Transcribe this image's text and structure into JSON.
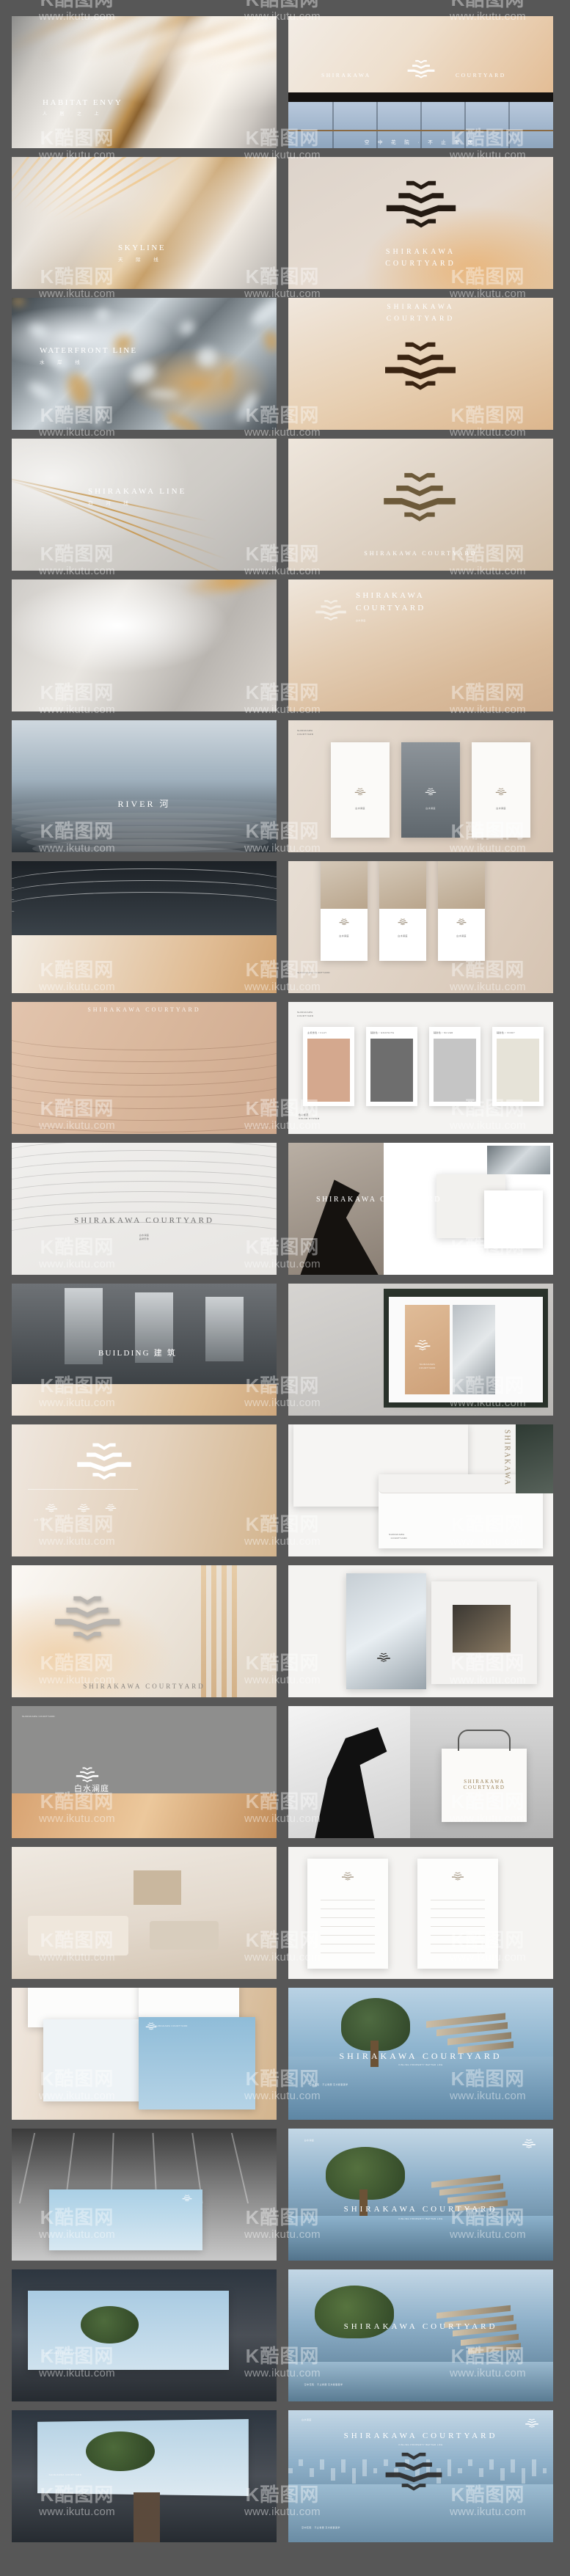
{
  "brand": {
    "name_en": "SHIRAKAWA COURTYARD",
    "name_en_line1": "SHIRAKAWA",
    "name_en_line2": "COURTYARD",
    "name_cn": "白水澜庭",
    "tagline_cn": "空 中 花 院 · 不 止 奢 居",
    "tagline_en": "KINLING PROPERTY BETTER LIFE",
    "logo_name": "wave-mark-logo"
  },
  "watermark": {
    "logo_text": "K酷图网",
    "url_text": "www.ikutu.com"
  },
  "colors": {
    "page_background": "#575757",
    "accent_gold": "#c39a62",
    "accent_clay": "#d7ab8f",
    "neutral_dark": "#6e6e6e",
    "neutral_mid": "#c5c5c5",
    "neutral_light": "#e6e3d8"
  },
  "palette": {
    "title": "色彩规范",
    "subtitle": "COLOR SYSTEM",
    "swatches": [
      {
        "label": "主视觉色 / CLAY",
        "hex": "#d4a88e"
      },
      {
        "label": "辅助色 / GRAPHITE",
        "hex": "#6e6e6e"
      },
      {
        "label": "辅助色 / SILVER",
        "hex": "#c5c5c5"
      },
      {
        "label": "辅助色 / IVORY",
        "hex": "#e6e3d8"
      }
    ]
  },
  "panels": [
    {
      "id": "p01",
      "name": "habitat-envy-silk",
      "caption_en": "HABITAT ENVY",
      "caption_cn": "人 居 之 上"
    },
    {
      "id": "p02",
      "name": "signage-wall-lobby",
      "caption_en": "SHIRAKAWA COURTYARD",
      "caption_cn": "空 中 花 院 · 不 止 奢 居"
    },
    {
      "id": "p03",
      "name": "skyline-architecture",
      "caption_en": "SKYLINE",
      "caption_cn": "天 际 线"
    },
    {
      "id": "p04",
      "name": "logo-texture-stone",
      "caption_en": "SHIRAKAWA COURTYARD",
      "caption_cn": ""
    },
    {
      "id": "p05",
      "name": "waterfront-texture",
      "caption_en": "WATERFRONT LINE",
      "caption_cn": "水 岸 线"
    },
    {
      "id": "p06",
      "name": "logo-texture-bronze",
      "caption_en": "SHIRAKAWA COURTYARD",
      "caption_cn": ""
    },
    {
      "id": "p07",
      "name": "shirakawa-line-glass",
      "caption_en": "SHIRAKAWA LINE",
      "caption_cn": "白 河 线"
    },
    {
      "id": "p08",
      "name": "logo-texture-gold",
      "caption_en": "SHIRAKAWA COURTYARD",
      "caption_cn": ""
    },
    {
      "id": "p09",
      "name": "silk-drape-neutral",
      "caption_en": "",
      "caption_cn": ""
    },
    {
      "id": "p10",
      "name": "logo-lockup-warm",
      "caption_en": "SHIRAKAWA COURTYARD",
      "caption_cn": ""
    },
    {
      "id": "p11",
      "name": "river-landscape",
      "caption_en": "RIVER",
      "caption_cn": "河"
    },
    {
      "id": "p12",
      "name": "poster-series-mockup",
      "caption_en": "SHIRAKAWA COURTYARD",
      "caption_cn": ""
    },
    {
      "id": "p13",
      "name": "dune-wave-lines",
      "caption_en": "",
      "caption_cn": ""
    },
    {
      "id": "p14",
      "name": "vertical-poster-set",
      "caption_en": "SHIRAKAWA COURTYARD",
      "caption_cn": ""
    },
    {
      "id": "p15",
      "name": "pattern-clay-waves",
      "caption_en": "SHIRAKAWA COURTYARD",
      "caption_cn": ""
    },
    {
      "id": "p16",
      "name": "color-palette-board",
      "caption_en": "COLOR SYSTEM",
      "caption_cn": "色 彩 规 范"
    },
    {
      "id": "p17",
      "name": "pattern-grey-waves",
      "caption_en": "SHIRAKAWA COURTYARD",
      "caption_cn": ""
    },
    {
      "id": "p18",
      "name": "editorial-fashion-board",
      "caption_en": "SHIRAKAWA COURTYARD",
      "caption_cn": ""
    },
    {
      "id": "p19",
      "name": "building-render",
      "caption_en": "BUILDING",
      "caption_cn": "建 筑"
    },
    {
      "id": "p20",
      "name": "brochure-board-mockup",
      "caption_en": "SHIRAKAWA COURTYARD",
      "caption_cn": ""
    },
    {
      "id": "p21",
      "name": "logo-construction-grid",
      "caption_en": "SHIRAKAWA COURTYARD",
      "caption_cn": ""
    },
    {
      "id": "p22",
      "name": "stationery-envelope",
      "caption_en": "SHIRAKAWA COURTYARD",
      "caption_cn": ""
    },
    {
      "id": "p23",
      "name": "logo-relief-metal",
      "caption_en": "SHIRAKAWA COURTYARD",
      "caption_cn": ""
    },
    {
      "id": "p24",
      "name": "folder-booklet-mockup",
      "caption_en": "SHIRAKAWA COURTYARD",
      "caption_cn": ""
    },
    {
      "id": "p25",
      "name": "dune-logo-plate",
      "caption_en": "SHIRAKAWA COURTYARD",
      "caption_cn": "白 水 澜 庭"
    },
    {
      "id": "p26",
      "name": "shopping-bag-mockup",
      "caption_en": "SHIRAKAWA COURTYARD",
      "caption_cn": ""
    },
    {
      "id": "p27",
      "name": "interior-living-room",
      "caption_en": "",
      "caption_cn": ""
    },
    {
      "id": "p28",
      "name": "rollup-banner-set",
      "caption_en": "SHIRAKAWA COURTYARD",
      "caption_cn": ""
    },
    {
      "id": "p29",
      "name": "billboard-print-set",
      "caption_en": "SHIRAKAWA COURTYARD",
      "caption_cn": ""
    },
    {
      "id": "p30",
      "name": "keyvisual-water-tree",
      "caption_en": "SHIRAKAWA COURTYARD",
      "caption_cn": "空中花院 · 不止奢居   东方叙事美学"
    },
    {
      "id": "p31",
      "name": "lobby-screen-mockup",
      "caption_en": "SHIRAKAWA COURTYARD",
      "caption_cn": ""
    },
    {
      "id": "p32",
      "name": "keyvisual-sky-tree",
      "caption_en": "SHIRAKAWA COURTYARD",
      "caption_cn": ""
    },
    {
      "id": "p33",
      "name": "bus-shelter-mockup",
      "caption_en": "SHIRAKAWA COURTYARD",
      "caption_cn": ""
    },
    {
      "id": "p34",
      "name": "keyvisual-horizon",
      "caption_en": "SHIRAKAWA COURTYARD",
      "caption_cn": "空中花院 · 不止奢居   东方叙事美学"
    },
    {
      "id": "p35",
      "name": "billboard-night-mockup",
      "caption_en": "SHIRAKAWA COURTYARD",
      "caption_cn": ""
    },
    {
      "id": "p36",
      "name": "keyvisual-waterline",
      "caption_en": "SHIRAKAWA COURTYARD",
      "caption_cn": "空中花院 · 不止奢居   东方叙事美学"
    }
  ]
}
